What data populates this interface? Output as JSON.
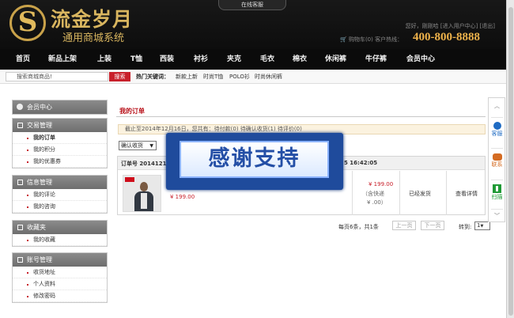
{
  "header": {
    "logo_mark": "S",
    "logo_text": "流金岁月",
    "logo_subtitle": "通用商城系统",
    "service_tab": "在线客服",
    "user_links": "您好，刚刚哈 [进入用户中心] [退出]",
    "cart": "购物车(0)",
    "hotline_label": "客户热线：",
    "hotline": "400-800-8888"
  },
  "nav": {
    "items": [
      "首页",
      "新品上架",
      "上装",
      "T恤",
      "西装",
      "衬衫",
      "夹克",
      "毛衣",
      "棉衣",
      "休闲裤",
      "牛仔裤",
      "会员中心"
    ]
  },
  "search": {
    "placeholder": "搜索商城商品!",
    "button": "搜索",
    "hot_label": "热门关键词：",
    "hot_keywords": [
      "新款上新",
      "时尚T恤",
      "POLO衫",
      "时尚休闲裤"
    ]
  },
  "sidebar": {
    "member_center": "会员中心",
    "sections": [
      {
        "title": "交易管理",
        "items": [
          "我的订单",
          "我的积分",
          "我的优惠券"
        ]
      },
      {
        "title": "信息管理",
        "items": [
          "我的评论",
          "我的咨询"
        ]
      },
      {
        "title": "收藏夹",
        "items": [
          "我的收藏"
        ]
      },
      {
        "title": "账号管理",
        "items": [
          "收货地址",
          "个人资料",
          "修改密码"
        ]
      }
    ]
  },
  "main": {
    "title": "我的订单",
    "notice": "截止至2014年12月16日，您共有：待付款(0)   待确认收货(1)   待评价(0)",
    "filter": "确认收货",
    "order": {
      "number": "订单号 2014121",
      "time": "5 16:42:05",
      "product_price": "¥ 199.00",
      "total": "¥ 199.00",
      "shipping": "（含快递",
      "shipping_fee": "¥ .00）",
      "status": "已经发货",
      "action": "查看详情"
    },
    "pager": {
      "summary": "每页6条，共1条",
      "prev": "上一页",
      "next": "下一页",
      "goto": "转到:",
      "page": "1"
    }
  },
  "overlay": {
    "text": "感谢支持"
  },
  "float_bar": {
    "items": [
      "客服",
      "联系",
      "扫描"
    ]
  },
  "colors": {
    "header": "#141414",
    "gold": "#d8b55f",
    "accent": "#c8202b",
    "overlay_blue": "#1f4b9c"
  }
}
